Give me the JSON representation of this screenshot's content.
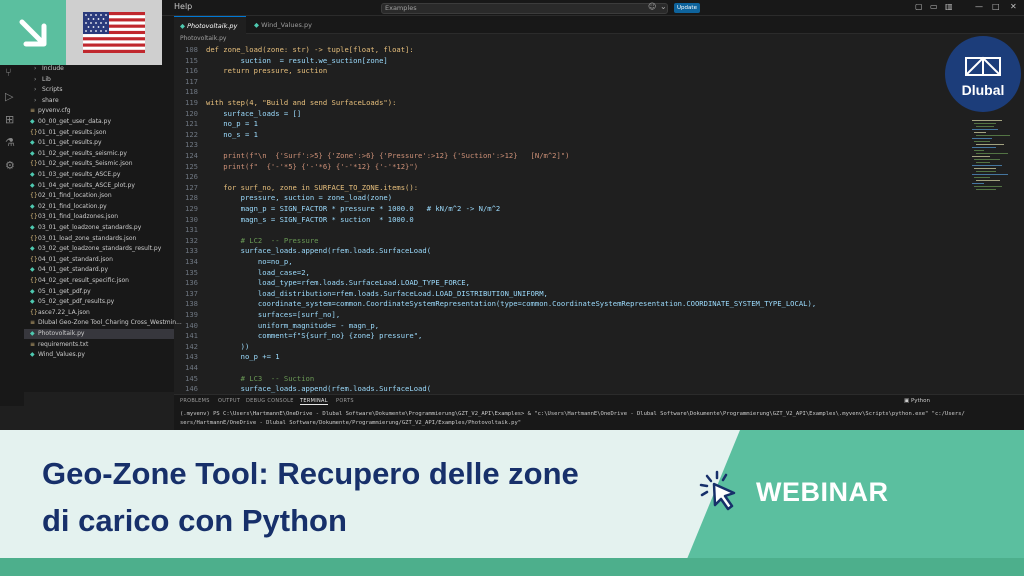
{
  "editor": {
    "menu_help": "Help",
    "command_center": "Examples",
    "update_label": "Update",
    "breadcrumb": "Photovoltaik.py",
    "tabs": [
      {
        "label": "Photovoltaik.py",
        "active": true
      },
      {
        "label": "Wind_Values.py",
        "active": false
      }
    ]
  },
  "explorer": {
    "items": [
      {
        "label": "Include",
        "type": "dir"
      },
      {
        "label": "Lib",
        "type": "dir"
      },
      {
        "label": "Scripts",
        "type": "dir"
      },
      {
        "label": "share",
        "type": "dir"
      },
      {
        "label": "pyvenv.cfg",
        "type": "file"
      },
      {
        "label": "00_00_get_user_data.py",
        "type": "py"
      },
      {
        "label": "01_01_get_results.json",
        "type": "json"
      },
      {
        "label": "01_01_get_results.py",
        "type": "py"
      },
      {
        "label": "01_02_get_results_seismic.py",
        "type": "py"
      },
      {
        "label": "01_02_get_results_Seismic.json",
        "type": "json"
      },
      {
        "label": "01_03_get_results_ASCE.py",
        "type": "py"
      },
      {
        "label": "01_04_get_results_ASCE_plot.py",
        "type": "py"
      },
      {
        "label": "02_01_find_location.json",
        "type": "json"
      },
      {
        "label": "02_01_find_location.py",
        "type": "py"
      },
      {
        "label": "03_01_find_loadzones.json",
        "type": "json"
      },
      {
        "label": "03_01_get_loadzone_standards.py",
        "type": "py"
      },
      {
        "label": "03_01_load_zone_standards.json",
        "type": "json"
      },
      {
        "label": "03_02_get_loadzone_standards_result.py",
        "type": "py"
      },
      {
        "label": "04_01_get_standard.json",
        "type": "json"
      },
      {
        "label": "04_01_get_standard.py",
        "type": "py"
      },
      {
        "label": "04_02_get_result_specific.json",
        "type": "json"
      },
      {
        "label": "05_01_get_pdf.py",
        "type": "py"
      },
      {
        "label": "05_02_get_pdf_results.py",
        "type": "py"
      },
      {
        "label": "asce7.22_LA.json",
        "type": "json"
      },
      {
        "label": "Dlubal Geo-Zone Tool_Charing Cross_Westmin...",
        "type": "file"
      },
      {
        "label": "Photovoltaik.py",
        "type": "py",
        "active": true
      },
      {
        "label": "requirements.txt",
        "type": "file"
      },
      {
        "label": "Wind_Values.py",
        "type": "py"
      }
    ]
  },
  "code_lines": [
    {
      "n": "108",
      "text": "def zone_load(zone: str) -> tuple[float, float]:"
    },
    {
      "n": "115",
      "text": "        suction  = result.we_suction[zone]"
    },
    {
      "n": "116",
      "text": "    return pressure, suction"
    },
    {
      "n": "117",
      "text": ""
    },
    {
      "n": "118",
      "text": ""
    },
    {
      "n": "119",
      "text": "with step(4, \"Build and send SurfaceLoads\"):"
    },
    {
      "n": "120",
      "text": "    surface_loads = []"
    },
    {
      "n": "121",
      "text": "    no_p = 1"
    },
    {
      "n": "122",
      "text": "    no_s = 1"
    },
    {
      "n": "123",
      "text": ""
    },
    {
      "n": "124",
      "text": "    print(f\"\\n  {'Surf':>5} {'Zone':>6} {'Pressure':>12} {'Suction':>12}   [N/m^2]\")"
    },
    {
      "n": "125",
      "text": "    print(f\"  {'-'*5} {'-'*6} {'-'*12} {'-'*12}\")"
    },
    {
      "n": "126",
      "text": ""
    },
    {
      "n": "127",
      "text": "    for surf_no, zone in SURFACE_TO_ZONE.items():"
    },
    {
      "n": "128",
      "text": "        pressure, suction = zone_load(zone)"
    },
    {
      "n": "129",
      "text": "        magn_p = SIGN_FACTOR * pressure * 1000.0   # kN/m^2 -> N/m^2"
    },
    {
      "n": "130",
      "text": "        magn_s = SIGN_FACTOR * suction  * 1000.0"
    },
    {
      "n": "131",
      "text": ""
    },
    {
      "n": "132",
      "text": "        # LC2  -- Pressure"
    },
    {
      "n": "133",
      "text": "        surface_loads.append(rfem.loads.SurfaceLoad("
    },
    {
      "n": "134",
      "text": "            no=no_p,"
    },
    {
      "n": "135",
      "text": "            load_case=2,"
    },
    {
      "n": "136",
      "text": "            load_type=rfem.loads.SurfaceLoad.LOAD_TYPE_FORCE,"
    },
    {
      "n": "137",
      "text": "            load_distribution=rfem.loads.SurfaceLoad.LOAD_DISTRIBUTION_UNIFORM,"
    },
    {
      "n": "138",
      "text": "            coordinate_system=common.CoordinateSystemRepresentation(type=common.CoordinateSystemRepresentation.COORDINATE_SYSTEM_TYPE_LOCAL),"
    },
    {
      "n": "139",
      "text": "            surfaces=[surf_no],"
    },
    {
      "n": "140",
      "text": "            uniform_magnitude= - magn_p,"
    },
    {
      "n": "141",
      "text": "            comment=f\"S{surf_no} {zone} pressure\","
    },
    {
      "n": "142",
      "text": "        ))"
    },
    {
      "n": "143",
      "text": "        no_p += 1"
    },
    {
      "n": "144",
      "text": ""
    },
    {
      "n": "145",
      "text": "        # LC3  -- Suction"
    },
    {
      "n": "146",
      "text": "        surface_loads.append(rfem.loads.SurfaceLoad("
    }
  ],
  "panel": {
    "tabs": [
      "PROBLEMS",
      "OUTPUT",
      "DEBUG CONSOLE",
      "TERMINAL",
      "PORTS"
    ],
    "active_tab": "TERMINAL",
    "shell": "Python",
    "terminal_lines": [
      "(.myvenv) PS C:\\Users\\HartmannE\\OneDrive - Dlubal Software\\Dokumente\\Programmierung\\GZT_V2_API\\Examples> & \"c:\\Users\\HartmannE\\OneDrive - Dlubal Software\\Dokumente\\Programmierung\\GZT_V2_API\\Examples\\.myvenv\\Scripts\\python.exe\" \"c:/Users/",
      "sers/HartmannE/OneDrive - Dlubal Software/Dokumente/Programmierung/GZT_V2_API/Examples/Photovoltaik.py\""
    ]
  },
  "brand": {
    "badge_text": "Dlubal",
    "badge_color": "#1c3d7a",
    "accent_green": "#5bbf9f"
  },
  "banner": {
    "title_line1": "Geo-Zone Tool: Recupero delle zone",
    "title_line2": "di carico con Python",
    "tag": "WEBINAR",
    "title_color": "#17306a"
  }
}
